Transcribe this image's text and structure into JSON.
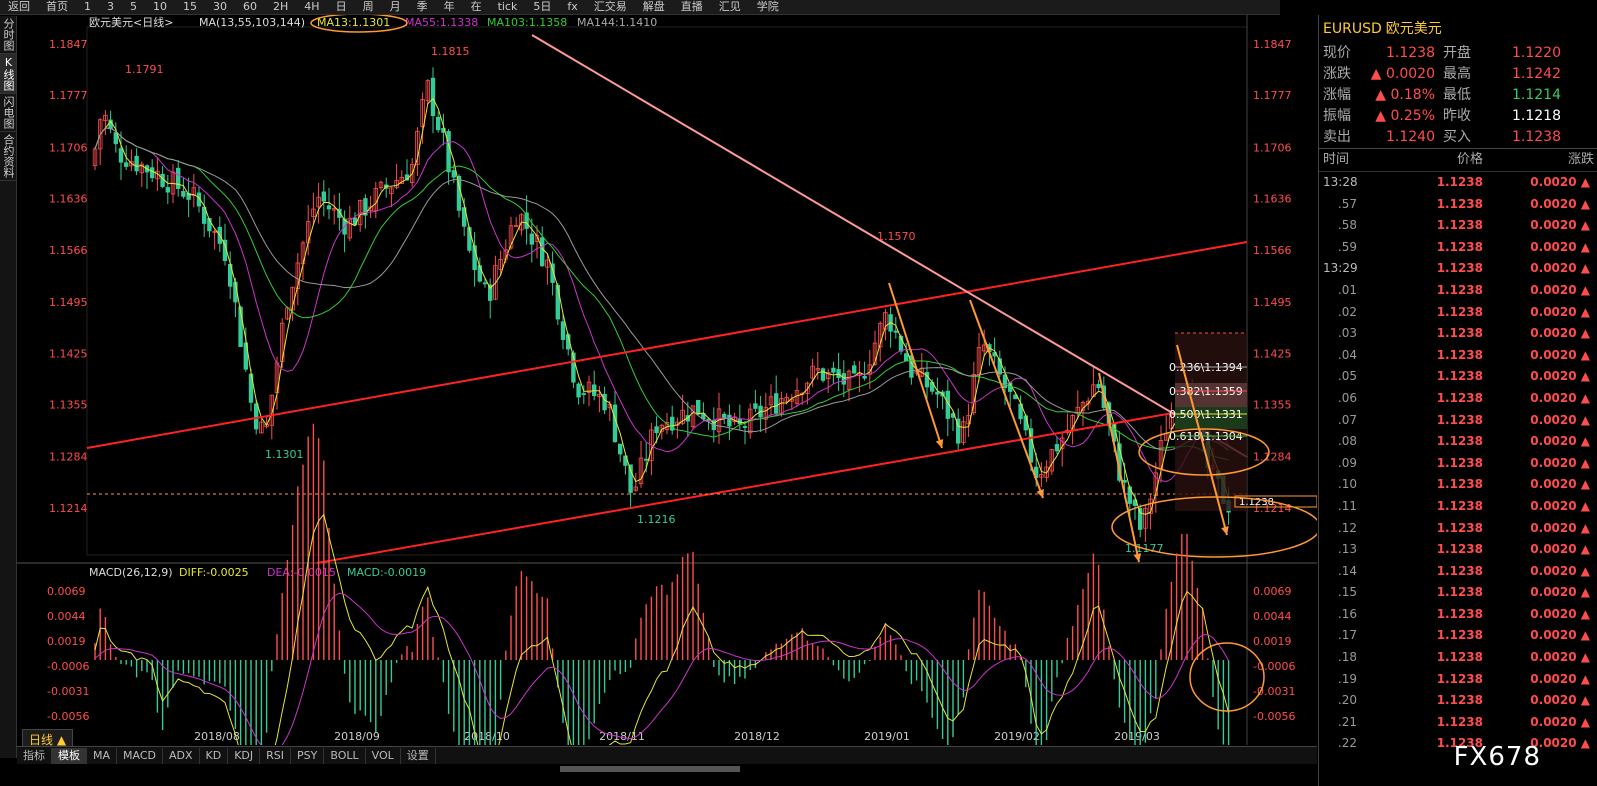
{
  "toolbar": {
    "items": [
      "返回",
      "首页",
      "1",
      "3",
      "5",
      "10",
      "15",
      "30",
      "60",
      "2H",
      "4H",
      "日",
      "周",
      "月",
      "季",
      "年",
      "在",
      "tick",
      "5日",
      "fx",
      "汇交易",
      "解盘",
      "直播",
      "汇见",
      "学院"
    ]
  },
  "vtabs": [
    "分时图",
    "K线图",
    "闪电图",
    "合约资料"
  ],
  "chart": {
    "header": "欧元美元<日线>",
    "ma_label": "MA(13,55,103,144)",
    "ma13": "MA13:1.1301",
    "ma55": "MA55:1.1338",
    "ma103": "MA103:1.1358",
    "ma144": "MA144:1.1410",
    "price_axis": [
      "1.1847",
      "1.1777",
      "1.1706",
      "1.1636",
      "1.1566",
      "1.1495",
      "1.1425",
      "1.1355",
      "1.1284",
      "1.1214"
    ],
    "date_axis": [
      "2018/08",
      "2018/09",
      "2018/10",
      "2018/11",
      "2018/12",
      "2019/01",
      "2019/02",
      "2019/03"
    ],
    "annotations": {
      "high1": "1.1791",
      "high2": "1.1815",
      "low1": "1.1301",
      "peak": "1.1570",
      "low2": "1.1216",
      "low3": "1.1177",
      "current": "1.1238"
    },
    "fib": [
      "0.236\\1.1394",
      "0.382\\1.1359",
      "0.500\\1.1331",
      "0.618\\1.1304"
    ],
    "macd_label": "MACD(26,12,9)",
    "diff": "DIFF:-0.0025",
    "dea": "DEA:-0.0015",
    "macd": "MACD:-0.0019",
    "macd_axis": [
      "0.0069",
      "0.0044",
      "0.0019",
      "-0.0006",
      "-0.0031",
      "-0.0056"
    ]
  },
  "panel": {
    "code": "EURUSD",
    "name": "欧元美元",
    "quote": [
      [
        "现价",
        "1.1238",
        "开盘",
        "1.1220"
      ],
      [
        "涨跌",
        "0.0020",
        "最高",
        "1.1242"
      ],
      [
        "涨幅",
        "0.18%",
        "最低",
        "1.1214"
      ],
      [
        "振幅",
        "0.25%",
        "昨收",
        "1.1218"
      ],
      [
        "卖出",
        "1.1240",
        "买入",
        "1.1238"
      ]
    ],
    "ticks_head": [
      "时间",
      "价格",
      "涨跌"
    ],
    "ticks": [
      [
        "13:28",
        "1.1238",
        "0.0020"
      ],
      [
        ".57",
        "1.1238",
        "0.0020"
      ],
      [
        ".58",
        "1.1238",
        "0.0020"
      ],
      [
        ".59",
        "1.1238",
        "0.0020"
      ],
      [
        "13:29",
        "1.1238",
        "0.0020"
      ],
      [
        ".01",
        "1.1238",
        "0.0020"
      ],
      [
        ".02",
        "1.1238",
        "0.0020"
      ],
      [
        ".03",
        "1.1238",
        "0.0020"
      ],
      [
        ".04",
        "1.1238",
        "0.0020"
      ],
      [
        ".05",
        "1.1238",
        "0.0020"
      ],
      [
        ".06",
        "1.1238",
        "0.0020"
      ],
      [
        ".07",
        "1.1238",
        "0.0020"
      ],
      [
        ".08",
        "1.1238",
        "0.0020"
      ],
      [
        ".09",
        "1.1238",
        "0.0020"
      ],
      [
        ".10",
        "1.1238",
        "0.0020"
      ],
      [
        ".11",
        "1.1238",
        "0.0020"
      ],
      [
        ".12",
        "1.1238",
        "0.0020"
      ],
      [
        ".13",
        "1.1238",
        "0.0020"
      ],
      [
        ".14",
        "1.1238",
        "0.0020"
      ],
      [
        ".15",
        "1.1238",
        "0.0020"
      ],
      [
        ".16",
        "1.1238",
        "0.0020"
      ],
      [
        ".17",
        "1.1238",
        "0.0020"
      ],
      [
        ".18",
        "1.1238",
        "0.0020"
      ],
      [
        ".19",
        "1.1238",
        "0.0020"
      ],
      [
        ".20",
        "1.1238",
        "0.0020"
      ],
      [
        ".21",
        "1.1238",
        "0.0020"
      ],
      [
        ".22",
        "1.1238",
        "0.0020"
      ]
    ]
  },
  "bottom": {
    "period": "日线",
    "tabs": [
      "指标",
      "模板",
      "MA",
      "MACD",
      "ADX",
      "KD",
      "KDJ",
      "RSI",
      "PSY",
      "BOLL",
      "VOL",
      "设置"
    ]
  },
  "watermark": "FX678",
  "colors": {
    "up": "#ff4d4d",
    "down": "#33cc99",
    "ma13": "#e6e633",
    "ma55": "#cc33cc",
    "ma103": "#33cc33",
    "ma144": "#999999",
    "annot": "#ff9933"
  }
}
